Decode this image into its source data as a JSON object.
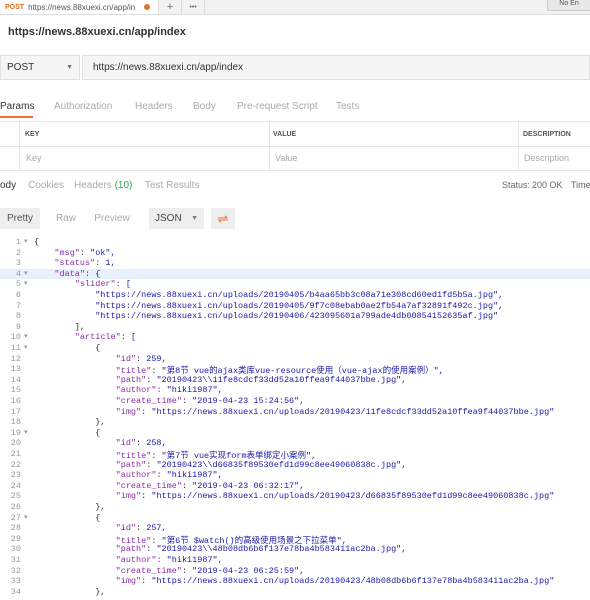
{
  "browser": {
    "tab": {
      "method": "POST",
      "url": "https://news.88xuexi.cn/app/in"
    },
    "add_label": "+",
    "more_label": "•••",
    "top_right_label": "No En"
  },
  "request": {
    "title": "https://news.88xuexi.cn/app/index",
    "method": "POST",
    "url": "https://news.88xuexi.cn/app/index"
  },
  "request_tabs": [
    "Params",
    "Authorization",
    "Headers",
    "Body",
    "Pre-request Script",
    "Tests"
  ],
  "params_table": {
    "headers": [
      "KEY",
      "VALUE",
      "DESCRIPTION"
    ],
    "placeholders": [
      "Key",
      "Value",
      "Description"
    ]
  },
  "response_tabs": {
    "body": "ody",
    "cookies": "Cookies",
    "headers": "Headers",
    "headers_count": "(10)",
    "test_results": "Test Results"
  },
  "status": {
    "label": "Status:",
    "value": "200 OK",
    "time_label": "Time"
  },
  "view_modes": [
    "Pretty",
    "Raw",
    "Preview"
  ],
  "format": "JSON",
  "code_lines": [
    {
      "n": "1",
      "f": "▾",
      "t": "{"
    },
    {
      "n": "2",
      "f": "",
      "t": "    \"msg\": \"ok\","
    },
    {
      "n": "3",
      "f": "",
      "t": "    \"status\": 1,"
    },
    {
      "n": "4",
      "f": "▾",
      "t": "    \"data\": {"
    },
    {
      "n": "5",
      "f": "▾",
      "t": "        \"slider\": ["
    },
    {
      "n": "6",
      "f": "",
      "t": "            \"https://news.88xuexi.cn/uploads/20190405/b4aa65bb3c08a71e308cd60ed1fd5b5a.jpg\","
    },
    {
      "n": "7",
      "f": "",
      "t": "            \"https://news.88xuexi.cn/uploads/20190405/9f7c08ebab0ae2fb54a7af32891f492c.jpg\","
    },
    {
      "n": "8",
      "f": "",
      "t": "            \"https://news.88xuexi.cn/uploads/20190406/423095601a799ade4db00854152635af.jpg\""
    },
    {
      "n": "9",
      "f": "",
      "t": "        ],"
    },
    {
      "n": "10",
      "f": "▾",
      "t": "        \"article\": ["
    },
    {
      "n": "11",
      "f": "▾",
      "t": "            {"
    },
    {
      "n": "12",
      "f": "",
      "t": "                \"id\": 259,"
    },
    {
      "n": "13",
      "f": "",
      "t": "                \"title\": \"第8节 vue的ajax类库vue-resource使用（vue-ajax的使用案例）\","
    },
    {
      "n": "14",
      "f": "",
      "t": "                \"path\": \"20190423\\\\11fe8cdcf33dd52a10ffea9f44037bbe.jpg\","
    },
    {
      "n": "15",
      "f": "",
      "t": "                \"author\": \"hiki1987\","
    },
    {
      "n": "16",
      "f": "",
      "t": "                \"create_time\": \"2019-04-23 15:24:56\","
    },
    {
      "n": "17",
      "f": "",
      "t": "                \"img\": \"https://news.88xuexi.cn/uploads/20190423/11fe8cdcf33dd52a10ffea9f44037bbe.jpg\""
    },
    {
      "n": "18",
      "f": "",
      "t": "            },"
    },
    {
      "n": "19",
      "f": "▾",
      "t": "            {"
    },
    {
      "n": "20",
      "f": "",
      "t": "                \"id\": 258,"
    },
    {
      "n": "21",
      "f": "",
      "t": "                \"title\": \"第7节 vue实现form表单绑定小案例\","
    },
    {
      "n": "22",
      "f": "",
      "t": "                \"path\": \"20190423\\\\d66835f89530efd1d99c8ee49060838c.jpg\","
    },
    {
      "n": "23",
      "f": "",
      "t": "                \"author\": \"hiki1987\","
    },
    {
      "n": "24",
      "f": "",
      "t": "                \"create_time\": \"2019-04-23 06:32:17\","
    },
    {
      "n": "25",
      "f": "",
      "t": "                \"img\": \"https://news.88xuexi.cn/uploads/20190423/d66835f89530efd1d99c8ee49060838c.jpg\""
    },
    {
      "n": "26",
      "f": "",
      "t": "            },"
    },
    {
      "n": "27",
      "f": "▾",
      "t": "            {"
    },
    {
      "n": "28",
      "f": "",
      "t": "                \"id\": 257,"
    },
    {
      "n": "29",
      "f": "",
      "t": "                \"title\": \"第6节 $watch()的高级使用场景之下拉菜单\","
    },
    {
      "n": "30",
      "f": "",
      "t": "                \"path\": \"20190423\\\\48b08db6b6f137e78ba4b583411ac2ba.jpg\","
    },
    {
      "n": "31",
      "f": "",
      "t": "                \"author\": \"hiki1987\","
    },
    {
      "n": "32",
      "f": "",
      "t": "                \"create_time\": \"2019-04-23 06:25:59\","
    },
    {
      "n": "33",
      "f": "",
      "t": "                \"img\": \"https://news.88xuexi.cn/uploads/20190423/48b08db6b6f137e78ba4b583411ac2ba.jpg\""
    },
    {
      "n": "34",
      "f": "",
      "t": "            },"
    }
  ]
}
